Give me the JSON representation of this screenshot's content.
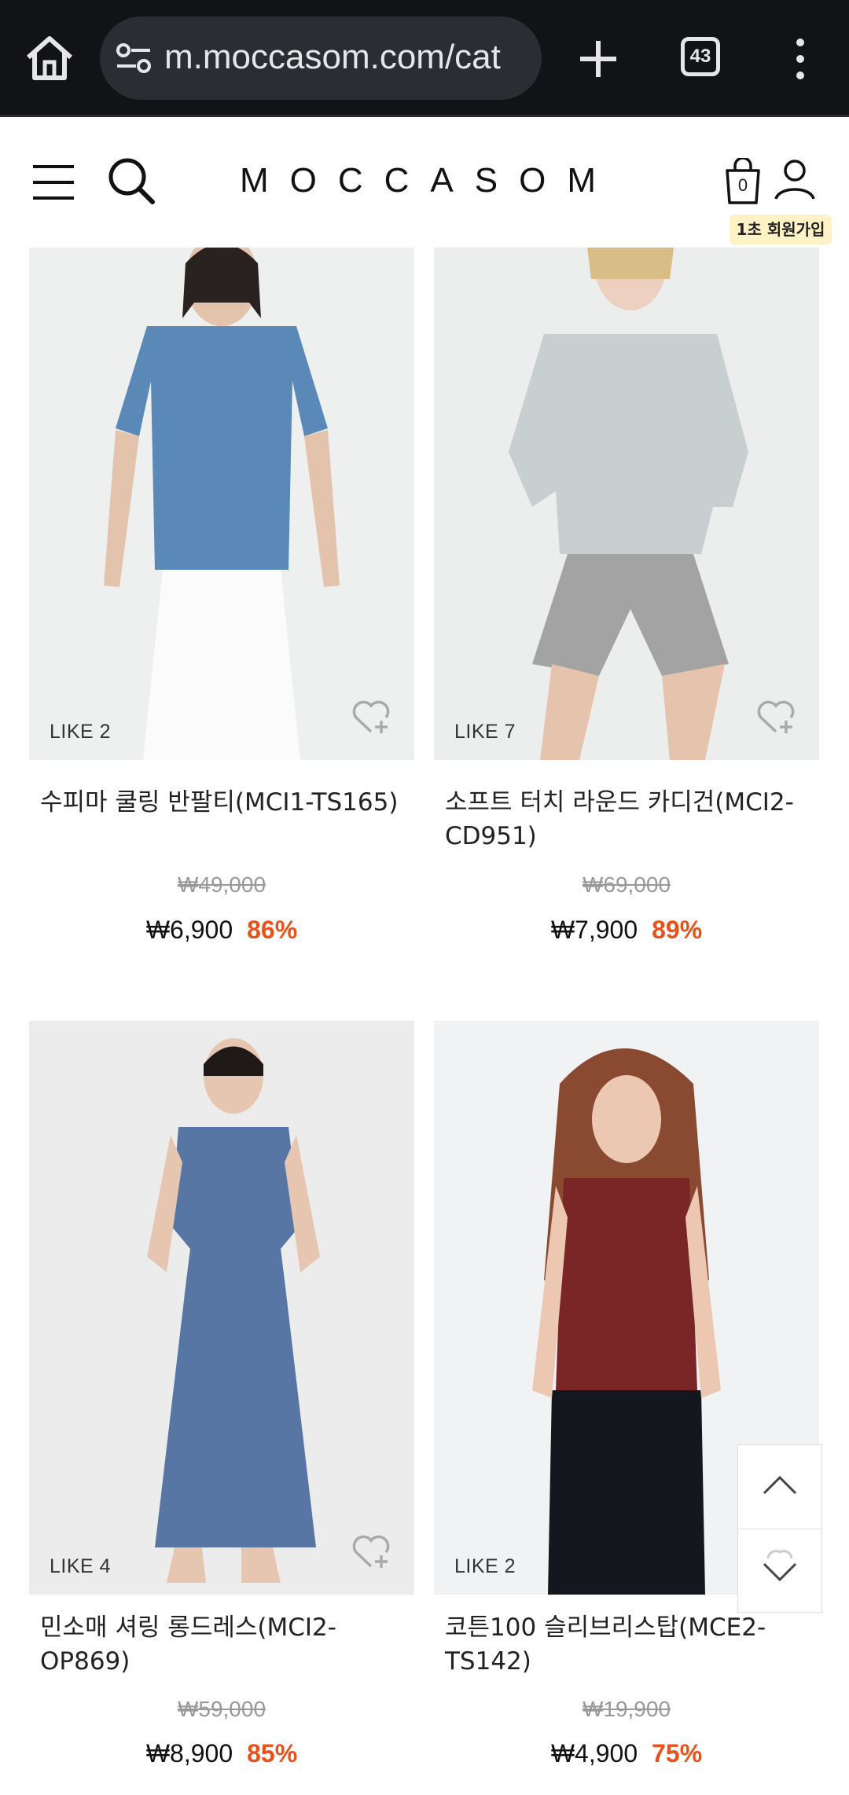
{
  "browser": {
    "url": "m.moccasom.com/cat",
    "tab_count": "43"
  },
  "header": {
    "logo": "MOCCASOM",
    "cart_count": "0",
    "signup_badge": "1초 회원가입"
  },
  "products": [
    {
      "likes": "LIKE 2",
      "name": "수피마 쿨링 반팔티(MCI1-TS165)",
      "original_price": "₩49,000",
      "price": "₩6,900",
      "discount": "86%",
      "garment_color": "#5a89b8"
    },
    {
      "likes": "LIKE 7",
      "name": "소프트 터치 라운드 카디건(MCI2-CD951)",
      "original_price": "₩69,000",
      "price": "₩7,900",
      "discount": "89%",
      "garment_color": "#c8cfd0"
    },
    {
      "likes": "LIKE 4",
      "name": "민소매 셔링 롱드레스(MCI2-OP869)",
      "original_price": "₩59,000",
      "price": "₩8,900",
      "discount": "85%",
      "garment_color": "#5876a4"
    },
    {
      "likes": "LIKE 2",
      "name": "코튼100 슬리브리스탑(MCE2-TS142)",
      "original_price": "₩19,900",
      "price": "₩4,900",
      "discount": "75%",
      "garment_color": "#7b2626"
    }
  ],
  "colors": {
    "discount": "#e9511b",
    "chrome_bg": "#121317",
    "badge_bg": "#fff2c4"
  },
  "icons": [
    "home-icon",
    "site-settings-icon",
    "new-tab-icon",
    "tab-switcher-icon",
    "more-menu-icon",
    "hamburger-menu-icon",
    "search-icon",
    "shopping-bag-icon",
    "account-icon",
    "wishlist-heart-icon",
    "scroll-up-icon",
    "scroll-down-icon"
  ]
}
